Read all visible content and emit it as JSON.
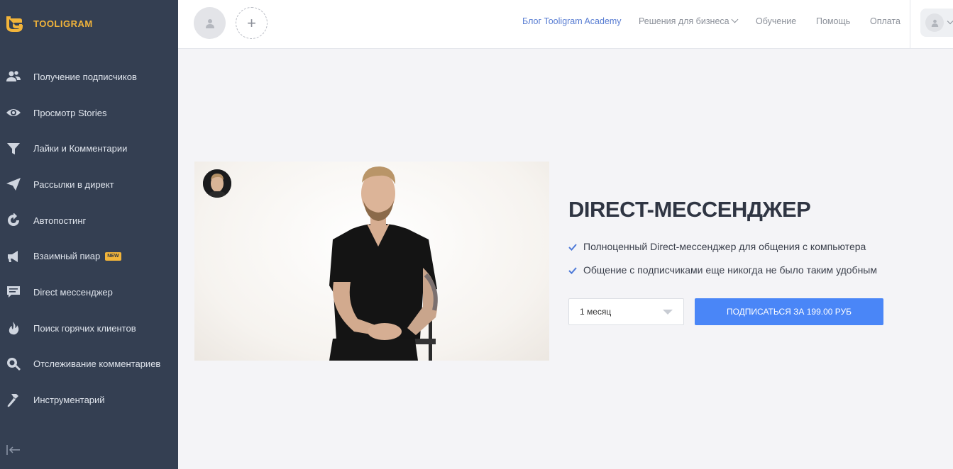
{
  "app": {
    "brand": "TOOLIGRAM",
    "brand_color": "#f2b43a",
    "accent_color": "#4a86f7",
    "sidebar_bg": "#343f52"
  },
  "sidebar": {
    "items": [
      {
        "label": "Получение подписчиков",
        "icon": "users-icon"
      },
      {
        "label": "Просмотр Stories",
        "icon": "eye-icon"
      },
      {
        "label": "Лайки и Комментарии",
        "icon": "funnel-icon"
      },
      {
        "label": "Рассылки в директ",
        "icon": "paper-plane-icon"
      },
      {
        "label": "Автопостинг",
        "icon": "refresh-icon"
      },
      {
        "label": "Взаимный пиар",
        "icon": "megaphone-icon",
        "badge": "NEW"
      },
      {
        "label": "Direct мессенджер",
        "icon": "message-icon"
      },
      {
        "label": "Поиск горячих клиентов",
        "icon": "fire-icon"
      },
      {
        "label": "Отслеживание комментариев",
        "icon": "search-icon"
      },
      {
        "label": "Инструментарий",
        "icon": "hammer-icon"
      }
    ],
    "collapse_icon": "collapse-left-icon"
  },
  "topbar": {
    "add_account_label": "+",
    "nav": {
      "blog": "Блог Tooligram Academy",
      "business": "Решения для бизнеса",
      "learning": "Обучение",
      "help": "Помощь",
      "payment": "Оплата"
    }
  },
  "main": {
    "title": "DIRECT-МЕССЕНДЖЕР",
    "features": [
      "Полноценный Direct-мессенджер для общения с компьютера",
      "Общение с подписчиками еще никогда не было таким удобным"
    ],
    "period_selected": "1 месяц",
    "subscribe_label": "ПОДПИСАТЬСЯ ЗА 199.00 РУБ"
  }
}
